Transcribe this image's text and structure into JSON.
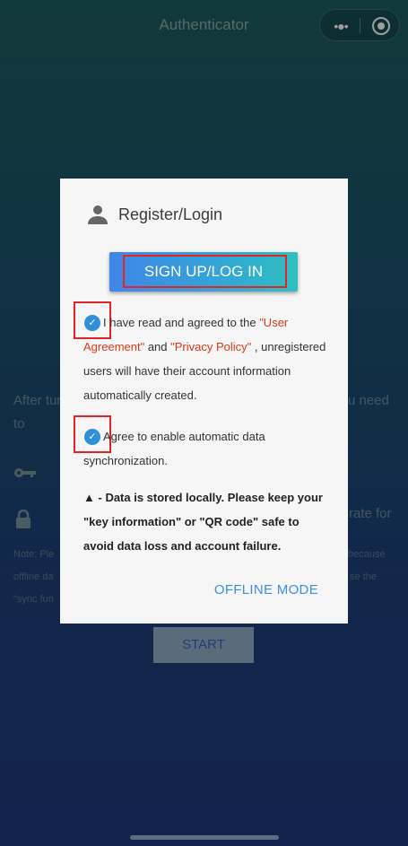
{
  "window": {
    "title": "Authenticator"
  },
  "background": {
    "partial_line1_left": "After tur",
    "partial_line1_right": "u need",
    "partial_line2": "to",
    "partial_line3_right": "rate for",
    "note_left1": "Note: Ple",
    "note_right1": "because",
    "note_left2": "offline da",
    "note_right2": "se the",
    "note_left3": "\"sync fun",
    "start_label": "START"
  },
  "dialog": {
    "title": "Register/Login",
    "signup_label": "SIGN UP/LOG IN",
    "agreement": {
      "text1": "I have read and agreed to the ",
      "link1": "\"User Agreement\"",
      "text2": " and ",
      "link2": "\"Privacy Policy\"",
      "text3": " , unregistered users will have their account information automatically created."
    },
    "sync_text": "Agree to enable automatic data synchronization.",
    "warning": "- Data is stored locally. Please keep your \"key information\" or \"QR code\" safe to avoid data loss and account failure.",
    "offline_label": "OFFLINE MODE"
  },
  "colors": {
    "accent": "#3f8fdf",
    "link": "#d83a18",
    "checkbox": "#2f8fd8",
    "annotation": "#e32424"
  },
  "icons": [
    "more-dots-icon",
    "target-icon",
    "key-icon",
    "lock-icon",
    "person-icon",
    "check-icon",
    "warning-icon"
  ]
}
